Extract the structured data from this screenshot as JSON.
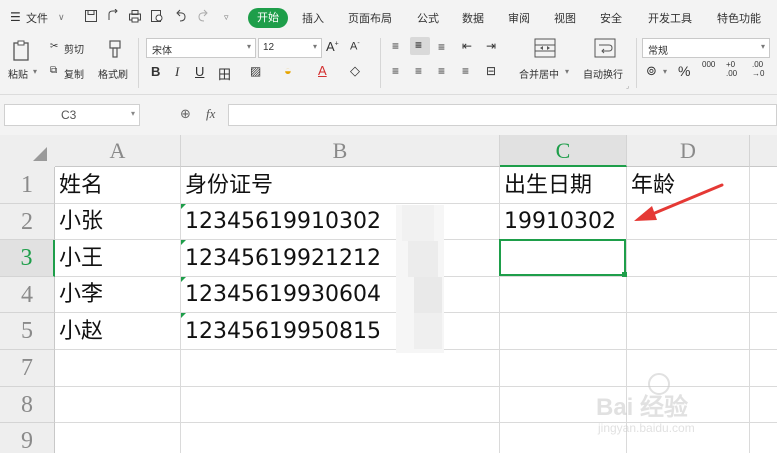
{
  "menubar": {
    "file": "文件",
    "tabs": [
      "开始",
      "插入",
      "页面布局",
      "公式",
      "数据",
      "审阅",
      "视图",
      "安全",
      "开发工具",
      "特色功能"
    ]
  },
  "ribbon": {
    "paste": "粘贴",
    "cut": "剪切",
    "copy": "复制",
    "format_painter": "格式刷",
    "font_name": "宋体",
    "font_size": "12",
    "merge_center": "合并居中",
    "wrap_text": "自动换行",
    "number_format": "常规",
    "percent": "%",
    "thousands": "000",
    "inc_decimal": "+0 .00",
    "dec_decimal": ".00 →0"
  },
  "formula_bar": {
    "name_box": "C3",
    "fx": "fx",
    "value": ""
  },
  "grid": {
    "columns": [
      "A",
      "B",
      "C",
      "D"
    ],
    "rows": [
      "1",
      "2",
      "3",
      "4",
      "5",
      "7",
      "8",
      "9"
    ],
    "cells": {
      "A1": "姓名",
      "B1": "身份证号",
      "C1": "出生日期",
      "D1": "年龄",
      "A2": "小张",
      "B2": "12345619910302",
      "C2": "19910302",
      "A3": "小王",
      "B3": "12345619921212",
      "A4": "小李",
      "B4": "12345619930604",
      "A5": "小赵",
      "B5": "12345619950815"
    },
    "selected_cell": "C3"
  },
  "watermark": {
    "brand": "Bai 经验",
    "url": "jingyan.baidu.com"
  },
  "colors": {
    "accent": "#1e9e4a",
    "arrow": "#e53935"
  }
}
